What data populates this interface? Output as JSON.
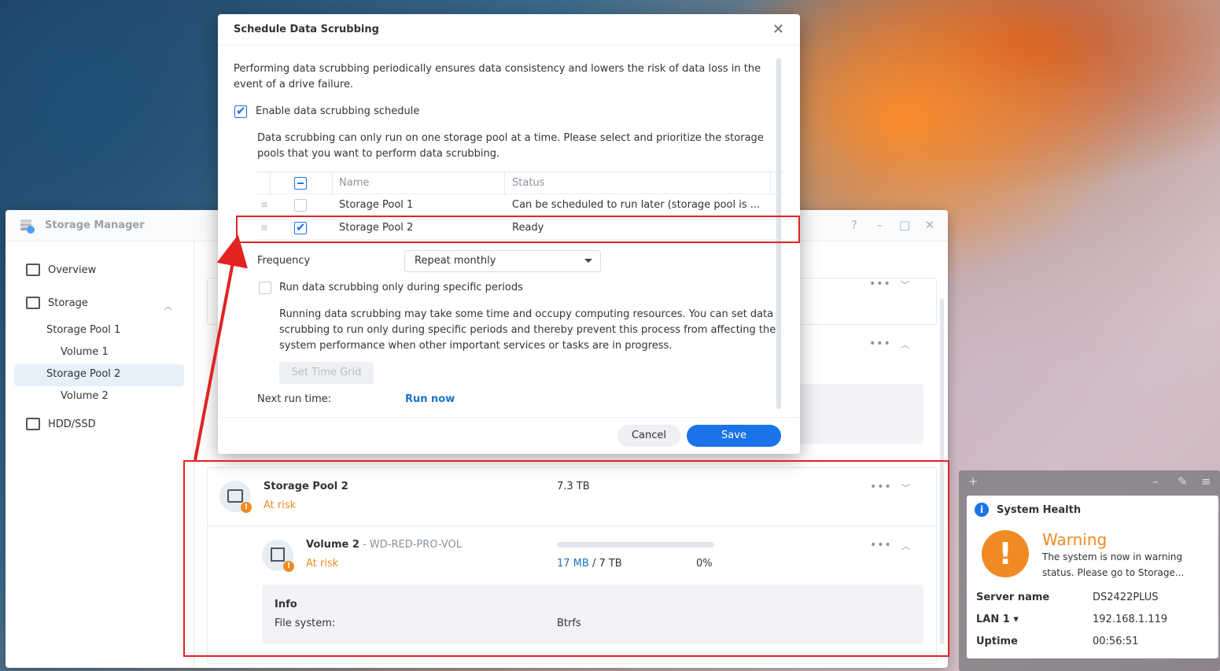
{
  "storage_manager": {
    "title": "Storage Manager",
    "controls": [
      "?",
      "–",
      "□",
      "✕"
    ],
    "sidebar": {
      "overview": "Overview",
      "storage": "Storage",
      "pool1": "Storage Pool 1",
      "vol1": "Volume 1",
      "pool2": "Storage Pool 2",
      "vol2": "Volume 2",
      "hdd": "HDD/SSD"
    },
    "pool_card": {
      "name": "Storage Pool 2",
      "status": "At risk",
      "size": "7.3 TB",
      "volume": {
        "name": "Volume 2",
        "subtitle": " - WD-RED-PRO-VOL",
        "status": "At risk",
        "used": "17 MB",
        "total": " / 7 TB",
        "percent": "0%",
        "usage_fraction": 0
      },
      "info": {
        "title": "Info",
        "fs_label": "File system:",
        "fs_value": "Btrfs"
      }
    }
  },
  "dialog": {
    "title": "Schedule Data Scrubbing",
    "intro": "Performing data scrubbing periodically ensures data consistency and lowers the risk of data loss in the event of a drive failure.",
    "enable_label": "Enable data scrubbing schedule",
    "enable_checked": true,
    "pool_note": "Data scrubbing can only run on one storage pool at a time. Please select and prioritize the storage pools that you want to perform data scrubbing.",
    "table": {
      "headers": {
        "name": "Name",
        "status": "Status"
      },
      "rows": [
        {
          "name": "Storage Pool 1",
          "status": "Can be scheduled to run later (storage pool is ...",
          "checked": false
        },
        {
          "name": "Storage Pool 2",
          "status": "Ready",
          "checked": true
        }
      ]
    },
    "frequency_label": "Frequency",
    "frequency_value": "Repeat monthly",
    "periods_label": "Run data scrubbing only during specific periods",
    "periods_note": "Running data scrubbing may take some time and occupy computing resources. You can set data scrubbing to run only during specific periods and thereby prevent this process from affecting the system performance when other important services or tasks are in progress.",
    "set_time_grid": "Set Time Grid",
    "next_run_label": "Next run time:",
    "next_run_value": "Run now",
    "cancel": "Cancel",
    "save": "Save"
  },
  "widget": {
    "title": "System Health",
    "status": "Warning",
    "description": "The system is now in warning status. Please go to Storage...",
    "rows": [
      {
        "key": "Server name",
        "value": "DS2422PLUS"
      },
      {
        "key": "LAN 1 ▾",
        "value": "192.168.1.119"
      },
      {
        "key": "Uptime",
        "value": "00:56:51"
      }
    ]
  },
  "colors": {
    "accent": "#1a73e8",
    "warning": "#f08a24",
    "annotation": "#e32222"
  }
}
